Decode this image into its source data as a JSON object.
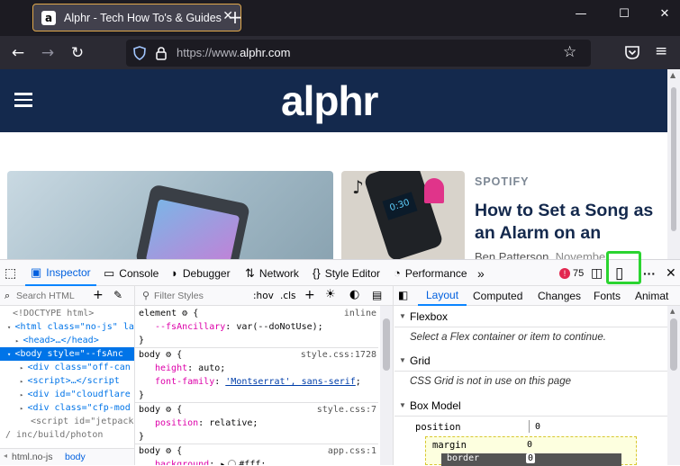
{
  "browser": {
    "tab_title": "Alphr - Tech How To's & Guides",
    "favicon_letter": "a",
    "url_prefix": "https://www.",
    "url_domain": "alphr.com"
  },
  "page": {
    "logo": "alphr",
    "card2_category": "SPOTIFY",
    "card2_headline": "How to Set a Song as an Alarm on an",
    "card2_byline": "Ben Patterson",
    "card2_date": "Novembe"
  },
  "devtools": {
    "tabs": [
      "Inspector",
      "Console",
      "Debugger",
      "Network",
      "Style Editor",
      "Performance"
    ],
    "error_count": "75",
    "search_html_placeholder": "Search HTML",
    "filter_styles_placeholder": "Filter Styles",
    "hov": ":hov",
    "cls": ".cls",
    "right_tabs": [
      "Layout",
      "Computed",
      "Changes",
      "Fonts",
      "Animat"
    ],
    "breadcrumbs": [
      "html.no-js",
      "body"
    ],
    "html_lines": [
      "<!DOCTYPE html>",
      "<html class=\"no-js\" la",
      "<head>…</head>",
      "<body style=\"--fsAnc",
      "<div class=\"off-can",
      "<script>…</script",
      "<div id=\"cloudflare",
      "<div class=\"cfp-mod",
      "<script id=\"jetpack",
      "/ inc/build/photon"
    ],
    "rules": [
      {
        "selector": "element",
        "source": "inline",
        "decls": [
          [
            "--fsAncillary",
            "var(--doNotUse)"
          ]
        ]
      },
      {
        "selector": "body",
        "source": "style.css:1728",
        "decls": [
          [
            "height",
            "auto"
          ],
          [
            "font-family",
            "'Montserrat', sans-serif"
          ]
        ]
      },
      {
        "selector": "body",
        "source": "style.css:7",
        "decls": [
          [
            "position",
            "relative"
          ]
        ]
      },
      {
        "selector": "body",
        "source": "app.css:1",
        "decls": [
          [
            "background",
            "#fff"
          ]
        ]
      }
    ],
    "layout": {
      "flexbox_title": "Flexbox",
      "flexbox_note": "Select a Flex container or item to continue.",
      "grid_title": "Grid",
      "grid_note": "CSS Grid is not in use on this page",
      "boxmodel_title": "Box Model",
      "position_label": "position",
      "position_value": "0",
      "margin_label": "margin",
      "margin_value": "0",
      "border_label": "border",
      "border_value": "0"
    }
  }
}
